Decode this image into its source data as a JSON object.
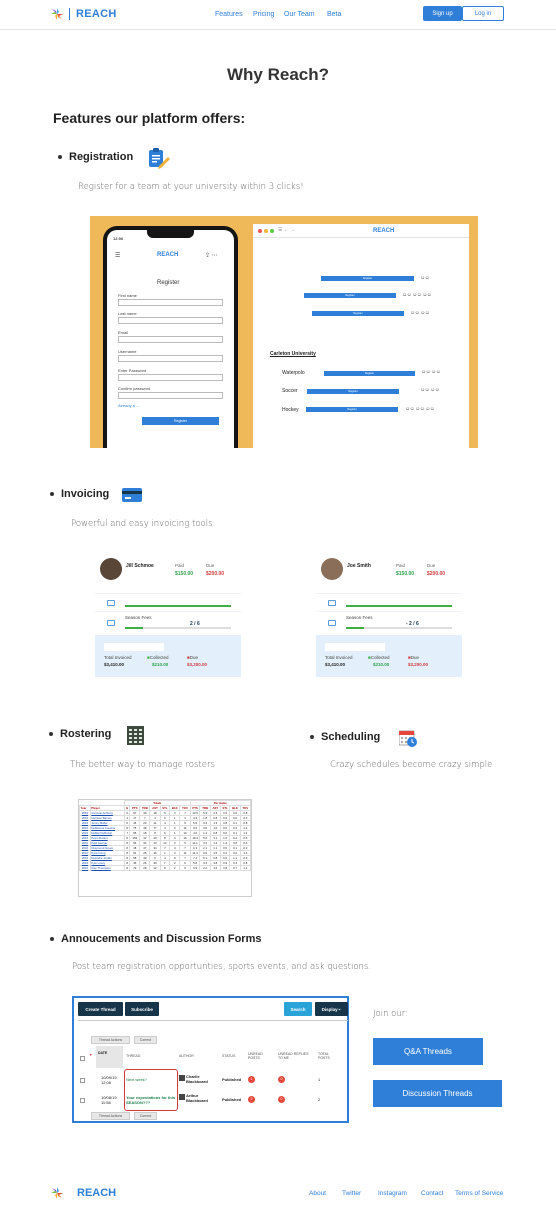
{
  "header": {
    "brand": "REACH",
    "nav": [
      "Features",
      "Pricing",
      "Our Team",
      "Beta"
    ],
    "signup": "Sign up",
    "login": "Log in"
  },
  "title": "Why Reach?",
  "subtitle": "Features our platform offers:",
  "features": {
    "registration": {
      "title": "Registration",
      "desc": "Register for a team at your university within 3 clicks!",
      "phone": {
        "time": "12:06",
        "brand": "REACH",
        "heading": "Register",
        "fields": [
          "First name",
          "Last name",
          "Email",
          "Username",
          "Enter Password",
          "Confirm password"
        ],
        "link": "Already a ...",
        "button": "Register"
      },
      "browser": {
        "brand": "REACH",
        "university": "Carleton University",
        "sports": [
          "Waterpolo",
          "Soccer",
          "Hockey"
        ],
        "button": "Register"
      }
    },
    "invoicing": {
      "title": "Invoicing",
      "desc": "Powerful and easy invoicing tools",
      "cards": [
        {
          "name": "Jill Schmoe",
          "paid_label": "Paid",
          "due_label": "Due",
          "paid": "$150.00",
          "due": "$200.00",
          "fee_label": "Season Fees",
          "fee_count": "2 / 6",
          "total_label": "Total Invoiced",
          "total": "$3,410.00",
          "collected_label": "Collected",
          "collected": "$210.00",
          "due_total_label": "Due",
          "due_total": "$3,200.00"
        },
        {
          "name": "Joe Smith",
          "paid_label": "Paid",
          "due_label": "Due",
          "paid": "$150.00",
          "due": "$200.00",
          "fee_label": "Season Fees",
          "fee_count": "- 2 / 6",
          "total_label": "Total Invoiced",
          "total": "$3,410.00",
          "collected_label": "Collected",
          "collected": "$210.00",
          "due_total_label": "Due",
          "due_total": "$3,200.00"
        }
      ]
    },
    "rostering": {
      "title": "Rostering",
      "desc": "The better way to manage rosters",
      "table": {
        "group_headers": [
          "Totals",
          "Per Game"
        ],
        "headers": [
          "Year",
          "Player",
          "G",
          "PTS",
          "TRB",
          "AST",
          "STL",
          "BLK",
          "TOV",
          "PTS",
          "TRB",
          "AST",
          "STL",
          "BLK",
          "TOV"
        ],
        "rows": [
          [
            "2016",
            "Carmelo Anthony",
            "6",
            "97",
            "40",
            "18",
            "5",
            "3",
            "7",
            "13.5",
            "5.3",
            "2.3",
            "0.6",
            "0.0",
            "0.8"
          ],
          [
            "2016",
            "Harrison Barnes",
            "4",
            "17",
            "7",
            "3",
            "0",
            "1",
            "1",
            "4.3",
            "1.8",
            "0.8",
            "0.0",
            "0.0",
            "0.3"
          ],
          [
            "2016",
            "Jimmy Butler",
            "6",
            "45",
            "20",
            "11",
            "4",
            "1",
            "9",
            "5.6",
            "3.3",
            "1.3",
            "0.8",
            "0.1",
            "0.8"
          ],
          [
            "2016",
            "DeMarcus Cousins",
            "8",
            "75",
            "48",
            "77",
            "4",
            "3",
            "11",
            "9.5",
            "3.8",
            "1.0",
            "0.5",
            "0.4",
            "1.4"
          ],
          [
            "2016",
            "DeMar DeRozan",
            "7",
            "65",
            "18",
            "8",
            "6",
            "1",
            "10",
            "4.6",
            "1.4",
            "0.8",
            "0.0",
            "0.1",
            "1.4"
          ],
          [
            "2016",
            "Kevin Durant",
            "8",
            "155",
            "42",
            "20",
            "8",
            "4",
            "16",
            "19.4",
            "5.6",
            "3.1",
            "1.0",
            "0.2",
            "0.6"
          ],
          [
            "2016",
            "Paul George",
            "8",
            "66",
            "34",
            "13",
            "13",
            "3",
            "5",
            "11.1",
            "4.3",
            "1.3",
            "1.3",
            "0.6",
            "0.6"
          ],
          [
            "2016",
            "Draymond Green",
            "8",
            "18",
            "47",
            "34",
            "7",
            "4",
            "7",
            "1.3",
            "2.1",
            "1.1",
            "0.5",
            "0.1",
            "0.3"
          ],
          [
            "2016",
            "Kyrie Irving",
            "8",
            "91",
            "25",
            "36",
            "1",
            "3",
            "11",
            "11.4",
            "3.5",
            "4.5",
            "0.4",
            "0.2",
            "1.4"
          ],
          [
            "2016",
            "DeAndre Jordan",
            "8",
            "58",
            "49",
            "6",
            "4",
            "9",
            "7",
            "7.4",
            "6.1",
            "0.8",
            "0.5",
            "1.1",
            "0.9"
          ],
          [
            "2016",
            "Kyle Lowry",
            "8",
            "46",
            "26",
            "30",
            "7",
            "2",
            "6",
            "5.8",
            "3.3",
            "3.8",
            "0.9",
            "0.3",
            "0.8"
          ],
          [
            "2016",
            "Klay Thompson",
            "8",
            "79",
            "28",
            "12",
            "8",
            "2",
            "9",
            "9.9",
            "2.2",
            "1.6",
            "0.8",
            "0.7",
            "1.1"
          ]
        ]
      }
    },
    "scheduling": {
      "title": "Scheduling",
      "desc": "Crazy schedules become crazy simple"
    },
    "announcements": {
      "title": "Annoucements and Discussion Forms",
      "desc": "Post team registration opportunties, sports events, and ask questions.",
      "forum": {
        "create": "Create Thread",
        "subscribe": "Subscribe",
        "search": "Search",
        "display": "Display",
        "thread_actions": "Thread Actions",
        "correct": "Correct",
        "columns": [
          "DATE",
          "THREAD",
          "AUTHOR",
          "STATUS",
          "UNREAD POSTS",
          "UNREAD REPLIES TO ME",
          "TOTAL POSTS"
        ],
        "rows": [
          {
            "date": "10/09/19 12:08",
            "thread": "Next week?",
            "author": "Charlie Blackboard",
            "status": "Published",
            "unread": "1",
            "unread_me": "0",
            "total": "1"
          },
          {
            "date": "10/08/19 11:58",
            "thread": "Your expectations for this SEASON???",
            "author": "Arthur Blackboard",
            "status": "Published",
            "unread": "2",
            "unread_me": "0",
            "total": "2"
          }
        ]
      },
      "join_label": "Join our:",
      "qa_button": "Q&A Threads",
      "discussion_button": "Discussion Threads"
    }
  },
  "footer": {
    "brand": "REACH",
    "links": [
      "About",
      "Twitter",
      "Instagram",
      "Contact",
      "Terms of Service"
    ]
  },
  "colors": {
    "accent": "#2f7fd9",
    "banner": "#efb95a",
    "dark": "#163549"
  }
}
